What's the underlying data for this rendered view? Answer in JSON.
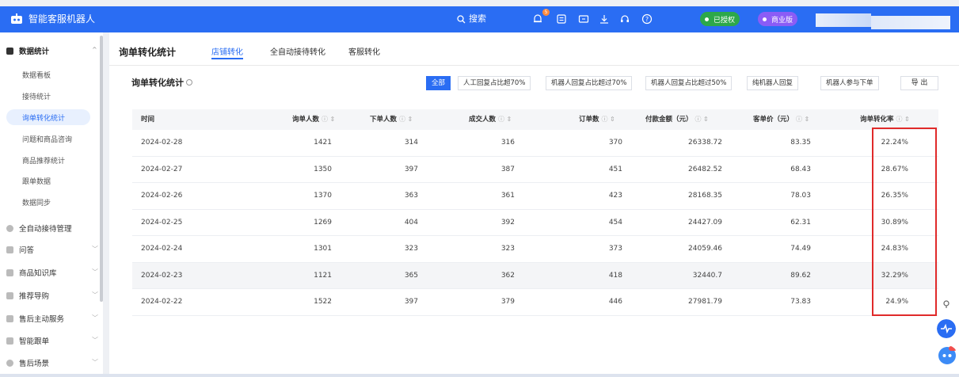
{
  "app": {
    "title": "智能客服机器人"
  },
  "topbar": {
    "search_label": "搜索",
    "notif_count": "5",
    "badges": [
      {
        "label": "已授权",
        "color": "#2da84a"
      },
      {
        "label": "商业版",
        "color": "#8b5cf6"
      }
    ]
  },
  "sidebar": {
    "groups": [
      {
        "label": "数据统计",
        "expanded": true
      },
      {
        "label": "全自动接待管理"
      },
      {
        "label": "问答"
      },
      {
        "label": "商品知识库"
      },
      {
        "label": "推荐导购"
      },
      {
        "label": "售后主动服务"
      },
      {
        "label": "智能跟单"
      },
      {
        "label": "售后场景"
      }
    ],
    "items": [
      {
        "label": "数据看板"
      },
      {
        "label": "接待统计"
      },
      {
        "label": "询单转化统计",
        "active": true
      },
      {
        "label": "问题和商品咨询"
      },
      {
        "label": "商品推荐统计"
      },
      {
        "label": "跟单数据"
      },
      {
        "label": "数据同步"
      }
    ]
  },
  "main": {
    "page_title": "询单转化统计",
    "tabs": [
      {
        "label": "店铺转化",
        "active": true
      },
      {
        "label": "全自动接待转化"
      },
      {
        "label": "客服转化"
      }
    ],
    "section_title": "询单转化统计",
    "filters": [
      {
        "label": "全部",
        "active": true
      },
      {
        "label": "人工回复占比超70%"
      },
      {
        "label": "机器人回复占比超过70%"
      },
      {
        "label": "机器人回复占比超过50%"
      },
      {
        "label": "纯机器人回复"
      },
      {
        "label": "机器人参与下单"
      }
    ],
    "export_label": "导 出",
    "table": {
      "columns": [
        "时间",
        "询单人数",
        "下单人数",
        "成交人数",
        "订单数",
        "付款金额（元）",
        "客单价（元）",
        "询单转化率"
      ],
      "rows": [
        [
          "2024-02-28",
          "1421",
          "314",
          "316",
          "370",
          "26338.72",
          "83.35",
          "22.24%"
        ],
        [
          "2024-02-27",
          "1350",
          "397",
          "387",
          "451",
          "26482.52",
          "68.43",
          "28.67%"
        ],
        [
          "2024-02-26",
          "1370",
          "363",
          "361",
          "423",
          "28168.35",
          "78.03",
          "26.35%"
        ],
        [
          "2024-02-25",
          "1269",
          "404",
          "392",
          "454",
          "24427.09",
          "62.31",
          "30.89%"
        ],
        [
          "2024-02-24",
          "1301",
          "323",
          "323",
          "373",
          "24059.46",
          "74.49",
          "24.83%"
        ],
        [
          "2024-02-23",
          "1121",
          "365",
          "362",
          "418",
          "32440.7",
          "89.62",
          "32.29%"
        ],
        [
          "2024-02-22",
          "1522",
          "397",
          "379",
          "446",
          "27981.79",
          "73.83",
          "24.9%"
        ]
      ]
    }
  },
  "colors": {
    "primary": "#2a6df3",
    "highlight_box": "#e02a2a"
  }
}
